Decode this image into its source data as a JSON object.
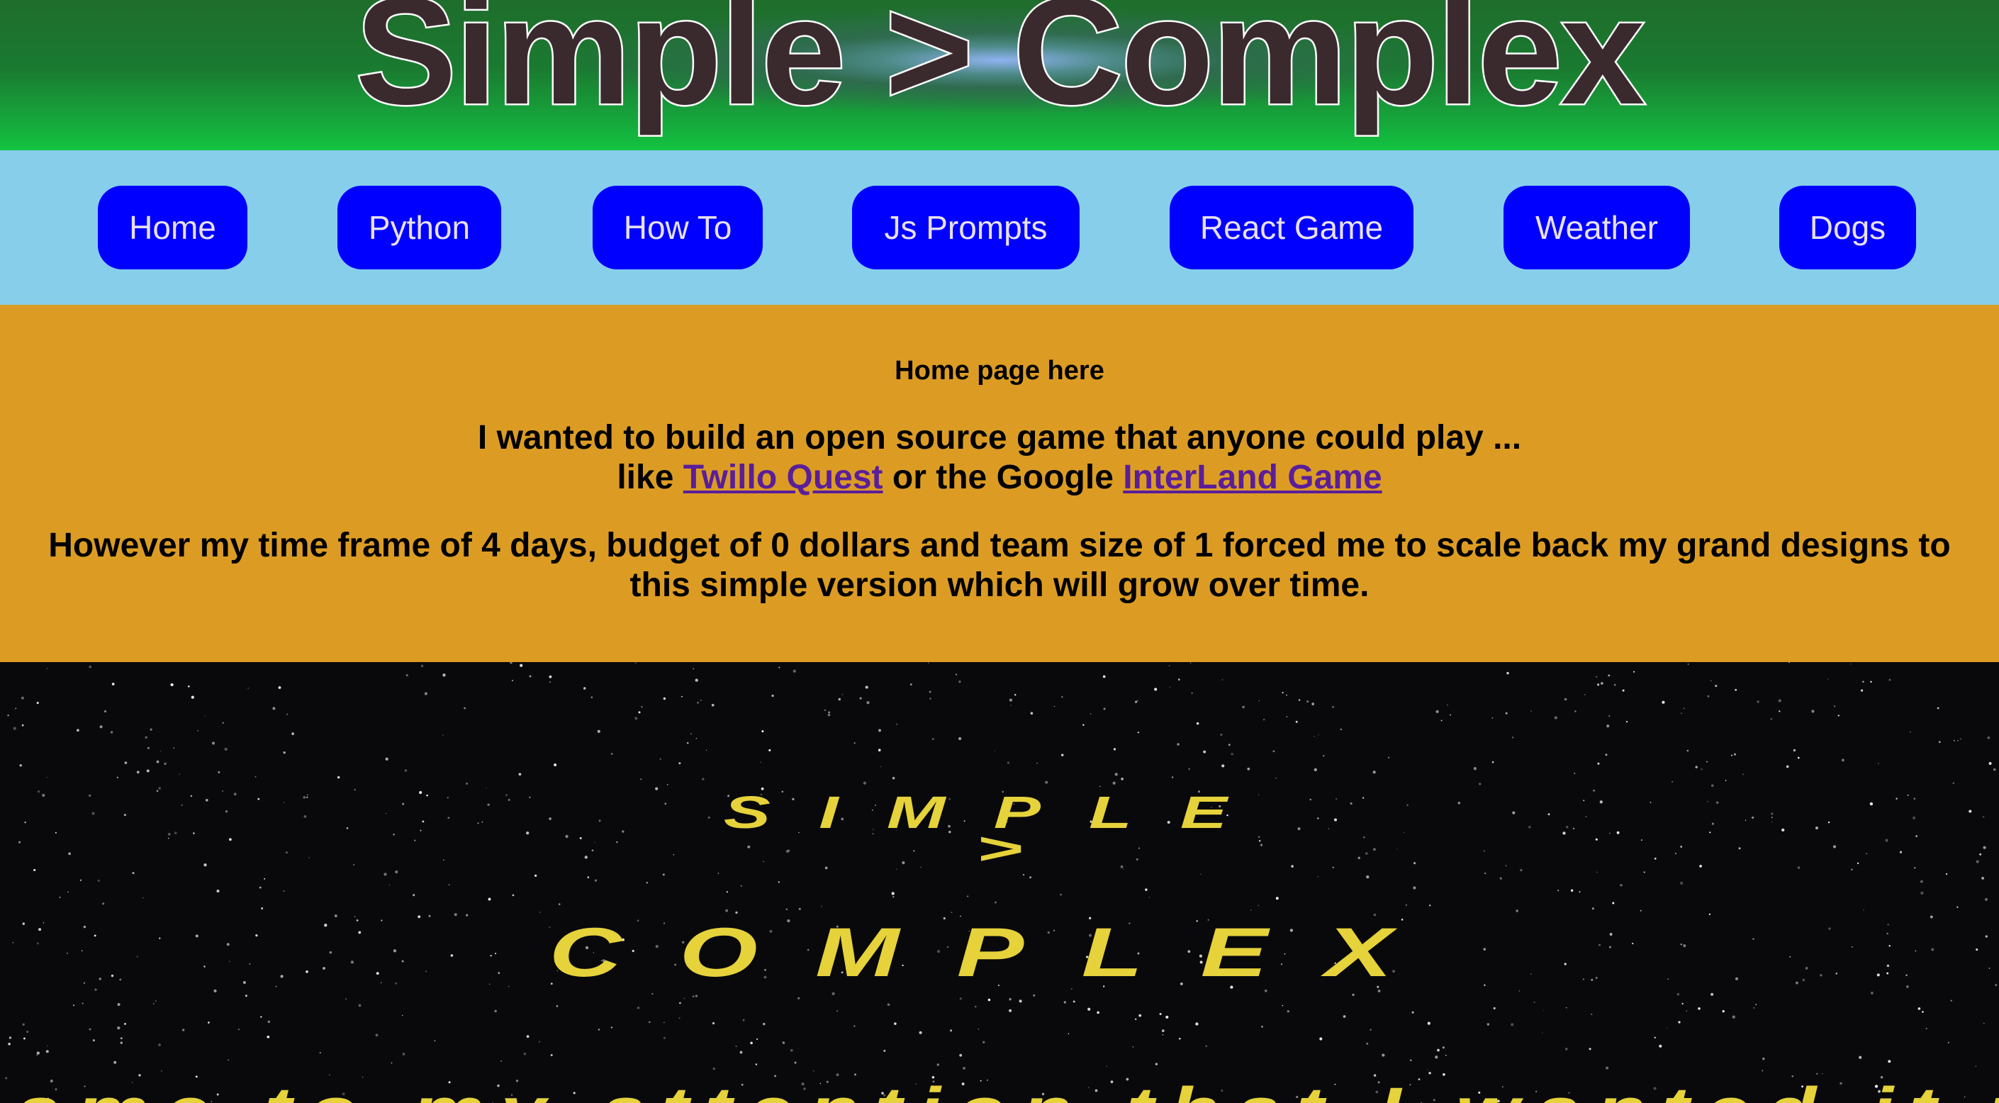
{
  "header": {
    "title": "Simple > Complex"
  },
  "nav": {
    "items": [
      {
        "label": "Home"
      },
      {
        "label": "Python"
      },
      {
        "label": "How To"
      },
      {
        "label": "Js Prompts"
      },
      {
        "label": "React Game"
      },
      {
        "label": "Weather"
      },
      {
        "label": "Dogs"
      }
    ]
  },
  "intro": {
    "heading": "Home page here",
    "line1": "I wanted to build an open source game that anyone could play ...",
    "line2_prefix": "like",
    "link1": "Twillo Quest",
    "line2_middle": "or the Google",
    "link2": "InterLand Game",
    "paragraph2": "However my time frame of 4 days, budget of 0 dollars and team size of 1 forced me to scale back my grand designs to this simple version which will grow over time."
  },
  "crawl": {
    "line1": "SIMPLE",
    "line2": ">",
    "line3": "COMPLEX",
    "line4": "\"...came to my attention that I wanted it to..."
  },
  "colors": {
    "nav_background": "#87ceeb",
    "nav_button": "#0000ff",
    "intro_background": "#dc9c24",
    "link": "#5a1e9a",
    "crawl_text": "#e6d23a",
    "space": "#09090c"
  }
}
